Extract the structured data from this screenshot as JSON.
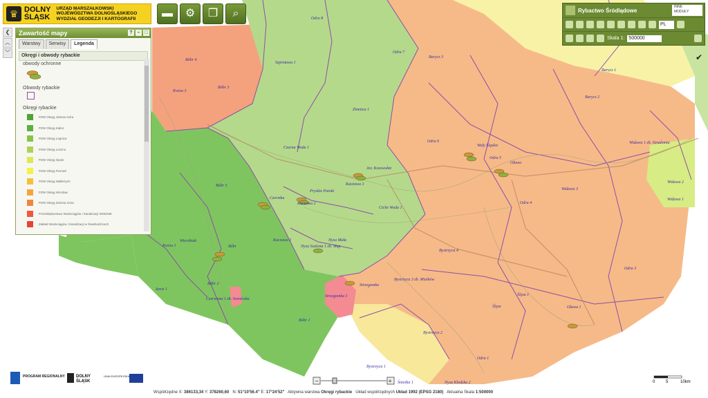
{
  "header": {
    "logo_brand_line1": "DOLNY",
    "logo_brand_line2": "ŚLĄSK",
    "logo_office_line1": "URZĄD MARSZAŁKOWSKI",
    "logo_office_line2": "WOJEWÓDZTWA DOLNOŚLĄSKIEGO",
    "logo_office_line3": "WYDZIAŁ GEODEZJI I KARTOGRAFII",
    "toolbar_icons": [
      "folder-icon",
      "gears-icon",
      "windows-icon",
      "magnifier-icon"
    ]
  },
  "panel": {
    "title": "Zawartość mapy",
    "tabs": [
      "Warstwy",
      "Serwisy",
      "Legenda"
    ],
    "active_tab": "Legenda",
    "legend_title": "Okręgi i obwody rybackie",
    "sections": {
      "protected": "obwody ochronne",
      "circuits": "Obwody rybackie",
      "districts": "Okręgi rybackie"
    },
    "district_items": [
      {
        "label": "PZW Okręg Jelenia Góra",
        "color": "#4fa33a"
      },
      {
        "label": "PZW Okręg Kalisz",
        "color": "#5cb040"
      },
      {
        "label": "PZW Okręg Legnica",
        "color": "#86c547"
      },
      {
        "label": "PZW Okręg Leszno",
        "color": "#a9d35a"
      },
      {
        "label": "PZW Okręg Opole",
        "color": "#d9ea57"
      },
      {
        "label": "PZW Okręg Poznań",
        "color": "#f2f24a"
      },
      {
        "label": "PZW Okręg Wałbrzych",
        "color": "#f1c23a"
      },
      {
        "label": "PZW Okręg Wrocław",
        "color": "#f2a640"
      },
      {
        "label": "PZW Okręg Zielona Góra",
        "color": "#ef8540"
      },
      {
        "label": "Przedsiębiorstwo Wodociągów i Kanalizacji WODNIK",
        "color": "#ef5a3a"
      },
      {
        "label": "Zakład Wodociągów i Kanalizacji w Świebodzicach",
        "color": "#e8423a"
      }
    ]
  },
  "right_panel": {
    "title": "Rybactwo Śródlądowe",
    "modules_line1": "INNE",
    "modules_line2": "MODUŁY",
    "language": "PL",
    "scale_label": "Skala 1:",
    "scale_value": "500000"
  },
  "map_labels": [
    "Odra 8",
    "Odra 7",
    "Bóbr 4",
    "Szprotawa 1",
    "Barycz 3",
    "Bóbr 3",
    "Kwisa 3",
    "Zimnica 1",
    "Barycz 2",
    "Czarna Woda 1",
    "Odra 6",
    "Wały Śląskie",
    "Widawa 1 zb. Stradomia",
    "Jez. Kosowskie",
    "Odra 5",
    "Oława",
    "Kaczawa 3",
    "Widawa 2",
    "Pryskie Potoki",
    "Bóbr 5",
    "Czermka",
    "Kaczawa 2",
    "Widawa 3",
    "Odra 4",
    "Ciche Woda 1",
    "Nysa Mała",
    "Nysa Szalona 1 zb. Słup",
    "Kaczawa 1",
    "Bystrzyca 4",
    "Bóbr",
    "Kwisa 1",
    "Bóbr 2",
    "Strzegomka",
    "Bystrzyca 3 zb. Mietków",
    "Ślęza 1",
    "Odra 3",
    "Izera 1",
    "Czerwona 1 zb. Sosnówka",
    "Strzegomka 1",
    "Bystrzyca 2",
    "Oława 1",
    "Bóbr 1",
    "Bystrzyca 1",
    "Ślęza",
    "Śnieżka 1",
    "Nysa Kłodzka 2",
    "Barycz 1",
    "Wierzbiak",
    "Odra 1",
    "Widawa 1"
  ],
  "footer": {
    "coords_x_label": "Współrzędne X:",
    "coords_x": "386133,34",
    "coords_y_label": "Y:",
    "coords_y": "378260,60",
    "lat_label": "N:",
    "lat": "51°10'56.4\"",
    "lon_label": "E:",
    "lon": "17°24'52\"",
    "layer_label": "Aktywna warstwa",
    "layer": "Okręgi rybackie",
    "crs_label": "Układ współrzędnych",
    "crs": "Układ 1992 (EPSG 2180)",
    "scale_label": "Aktualna Skala",
    "scale": "1:500000",
    "scalebar_ticks": [
      "0",
      "5",
      "10km"
    ],
    "logo_program": "PROGRAM REGIONALNY",
    "logo_ds_1": "DOLNY",
    "logo_ds_2": "ŚLĄSK",
    "logo_eu": "UNIA EUROPEJSKA"
  },
  "colors": {
    "toolbar": "#5f7f2a",
    "green_dark": "#7cc45e",
    "green_light": "#b8dc8c",
    "orange": "#f6b985",
    "salmon": "#f2a77a",
    "yellow": "#f7f0a0",
    "pink": "#f48a92",
    "outline": "#8b4ea8",
    "roads": "#c89c7a"
  }
}
